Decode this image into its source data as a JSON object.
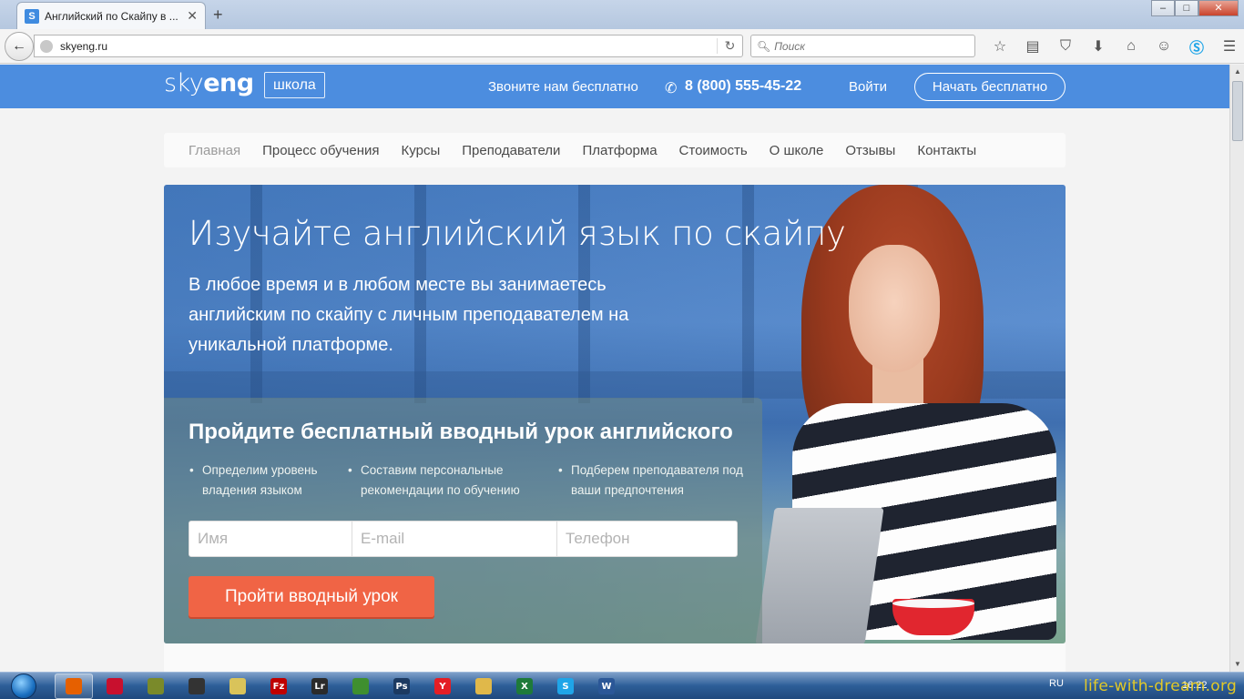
{
  "browser": {
    "tab_title": "Английский по Скайпу в ...",
    "tab_favicon": "S",
    "url": "skyeng.ru",
    "search_placeholder": "Поиск",
    "toolbar_icons": [
      "star-icon",
      "reading-list-icon",
      "pocket-icon",
      "download-icon",
      "home-icon",
      "chat-icon",
      "skype-icon",
      "menu-icon"
    ]
  },
  "header": {
    "logo_light": "sky",
    "logo_bold": "eng",
    "school_badge": "школа",
    "call_text": "Звоните нам бесплатно",
    "phone": "8 (800) 555-45-22",
    "login": "Войти",
    "start_button": "Начать бесплатно",
    "brand_color": "#4c8ddf"
  },
  "nav": {
    "items": [
      {
        "label": "Главная",
        "active": true
      },
      {
        "label": "Процесс обучения"
      },
      {
        "label": "Курсы"
      },
      {
        "label": "Преподаватели"
      },
      {
        "label": "Платформа"
      },
      {
        "label": "Стоимость"
      },
      {
        "label": "О школе"
      },
      {
        "label": "Отзывы"
      },
      {
        "label": "Контакты"
      }
    ]
  },
  "hero": {
    "title": "Изучайте английский язык по скайпу",
    "subtitle": "В любое время и в любом месте вы занимаетесь английским по скайпу с личным преподавателем на уникальной платформе.",
    "form": {
      "title": "Пройдите бесплатный вводный урок английского",
      "benefits": [
        "Определим уровень владения языком",
        "Составим персональные рекомендации по обучению",
        "Подберем преподавателя под ваши предпочтения"
      ],
      "name_placeholder": "Имя",
      "email_placeholder": "E-mail",
      "phone_placeholder": "Телефон",
      "submit": "Пройти вводный урок",
      "submit_color": "#f06445"
    }
  },
  "taskbar": {
    "lang": "RU",
    "time": "16:22",
    "watermark": "life-with-dream.org",
    "apps": [
      {
        "icon": "firefox-icon",
        "glyph": "",
        "color": "#e66000",
        "active": true
      },
      {
        "icon": "media-icon",
        "glyph": "",
        "color": "#c8102e"
      },
      {
        "icon": "pinwheel-icon",
        "glyph": "",
        "color": "#7a8a2a"
      },
      {
        "icon": "camera-icon",
        "glyph": "",
        "color": "#333333"
      },
      {
        "icon": "notepad-icon",
        "glyph": "",
        "color": "#d9c35a"
      },
      {
        "icon": "filezilla-icon",
        "glyph": "Fz",
        "color": "#bf0000"
      },
      {
        "icon": "lightroom-icon",
        "glyph": "Lr",
        "color": "#2b2b2b"
      },
      {
        "icon": "green-app-icon",
        "glyph": "",
        "color": "#3f8f2f"
      },
      {
        "icon": "photoshop-icon",
        "glyph": "Ps",
        "color": "#1c3a61"
      },
      {
        "icon": "yandex-icon",
        "glyph": "Y",
        "color": "#e41e25"
      },
      {
        "icon": "explorer-icon",
        "glyph": "",
        "color": "#e0b84a"
      },
      {
        "icon": "excel-icon",
        "glyph": "X",
        "color": "#1e7a3a"
      },
      {
        "icon": "skype-icon",
        "glyph": "S",
        "color": "#1fa5e8"
      },
      {
        "icon": "word-icon",
        "glyph": "W",
        "color": "#2b5797"
      }
    ]
  }
}
